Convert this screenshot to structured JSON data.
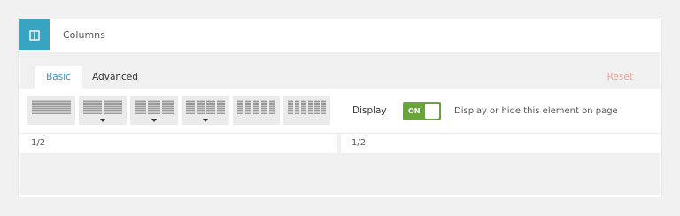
{
  "header": {
    "title": "Columns",
    "icon": "columns-icon",
    "accent_color": "#39a3c2"
  },
  "tabs": [
    {
      "label": "Basic",
      "active": true
    },
    {
      "label": "Advanced",
      "active": false
    }
  ],
  "reset_label": "Reset",
  "layouts": [
    {
      "name": "1 column",
      "columns": 1,
      "has_dropdown": false
    },
    {
      "name": "2 columns",
      "columns": 2,
      "has_dropdown": true
    },
    {
      "name": "3 columns",
      "columns": 3,
      "has_dropdown": true
    },
    {
      "name": "4 columns",
      "columns": 4,
      "has_dropdown": true
    },
    {
      "name": "5 columns",
      "columns": 5,
      "has_dropdown": false
    },
    {
      "name": "6 columns",
      "columns": 6,
      "has_dropdown": false
    }
  ],
  "display": {
    "label": "Display",
    "toggle_state": "ON",
    "description": "Display or hide this element on page",
    "toggle_color": "#6aa43a"
  },
  "columns": [
    {
      "label": "1/2"
    },
    {
      "label": "1/2"
    }
  ]
}
